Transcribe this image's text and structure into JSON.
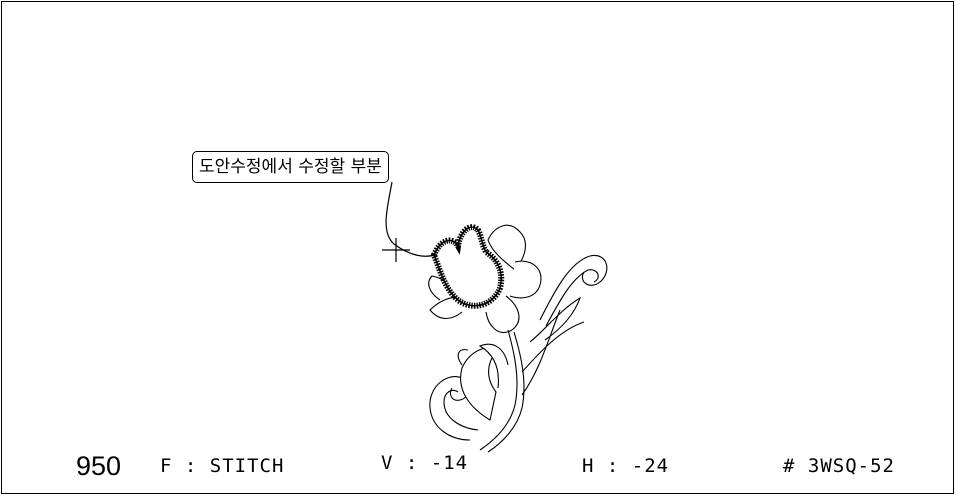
{
  "callout_label": "도안수정에서 수정할 부분",
  "status_bar": {
    "stitch_count": "950",
    "mode": "F : STITCH",
    "vertical": "V : -14",
    "horizontal": "H : -24",
    "design_code": "# 3WSQ-52"
  }
}
